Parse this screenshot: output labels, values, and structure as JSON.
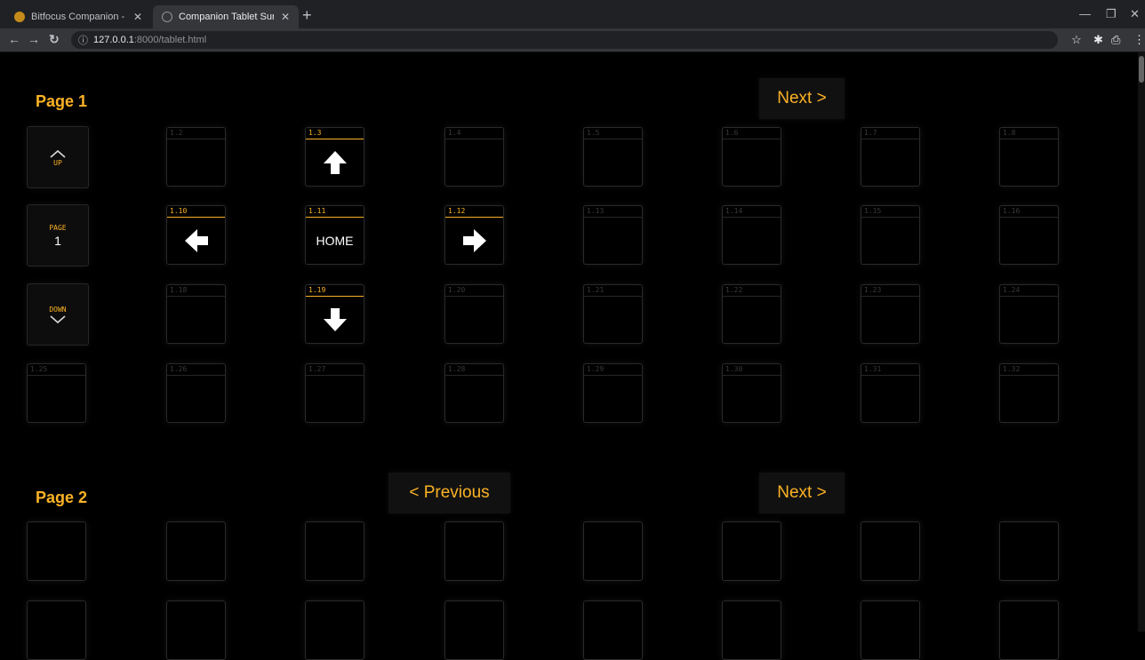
{
  "browser": {
    "tabs": [
      {
        "title": "Bitfocus Companion - Admin",
        "active": false
      },
      {
        "title": "Companion Tablet Surface",
        "active": true
      }
    ],
    "url_host": "127.0.0.1",
    "url_path": ":8000/tablet.html"
  },
  "page1": {
    "label": "Page 1",
    "next_label": "Next >",
    "controls": {
      "up_label": "UP",
      "page_label": "PAGE",
      "page_number": "1",
      "down_label": "DOWN"
    },
    "rows": [
      [
        {
          "id": "1.2"
        },
        {
          "id": "1.3",
          "icon": "arrow-up-icon"
        },
        {
          "id": "1.4"
        },
        {
          "id": "1.5"
        },
        {
          "id": "1.6"
        },
        {
          "id": "1.7"
        },
        {
          "id": "1.8"
        }
      ],
      [
        {
          "id": "1.10",
          "icon": "arrow-left-icon"
        },
        {
          "id": "1.11",
          "text": "HOME"
        },
        {
          "id": "1.12",
          "icon": "arrow-right-icon"
        },
        {
          "id": "1.13"
        },
        {
          "id": "1.14"
        },
        {
          "id": "1.15"
        },
        {
          "id": "1.16"
        }
      ],
      [
        {
          "id": "1.18"
        },
        {
          "id": "1.19",
          "icon": "arrow-down-icon"
        },
        {
          "id": "1.20"
        },
        {
          "id": "1.21"
        },
        {
          "id": "1.22"
        },
        {
          "id": "1.23"
        },
        {
          "id": "1.24"
        }
      ],
      [
        {
          "id": "1.25"
        },
        {
          "id": "1.26"
        },
        {
          "id": "1.27"
        },
        {
          "id": "1.28"
        },
        {
          "id": "1.29"
        },
        {
          "id": "1.30"
        },
        {
          "id": "1.31"
        },
        {
          "id": "1.32"
        }
      ]
    ]
  },
  "page2": {
    "label": "Page 2",
    "previous_label": "< Previous",
    "next_label": "Next >"
  },
  "colors": {
    "accent": "#fbb225",
    "background": "#000000"
  }
}
